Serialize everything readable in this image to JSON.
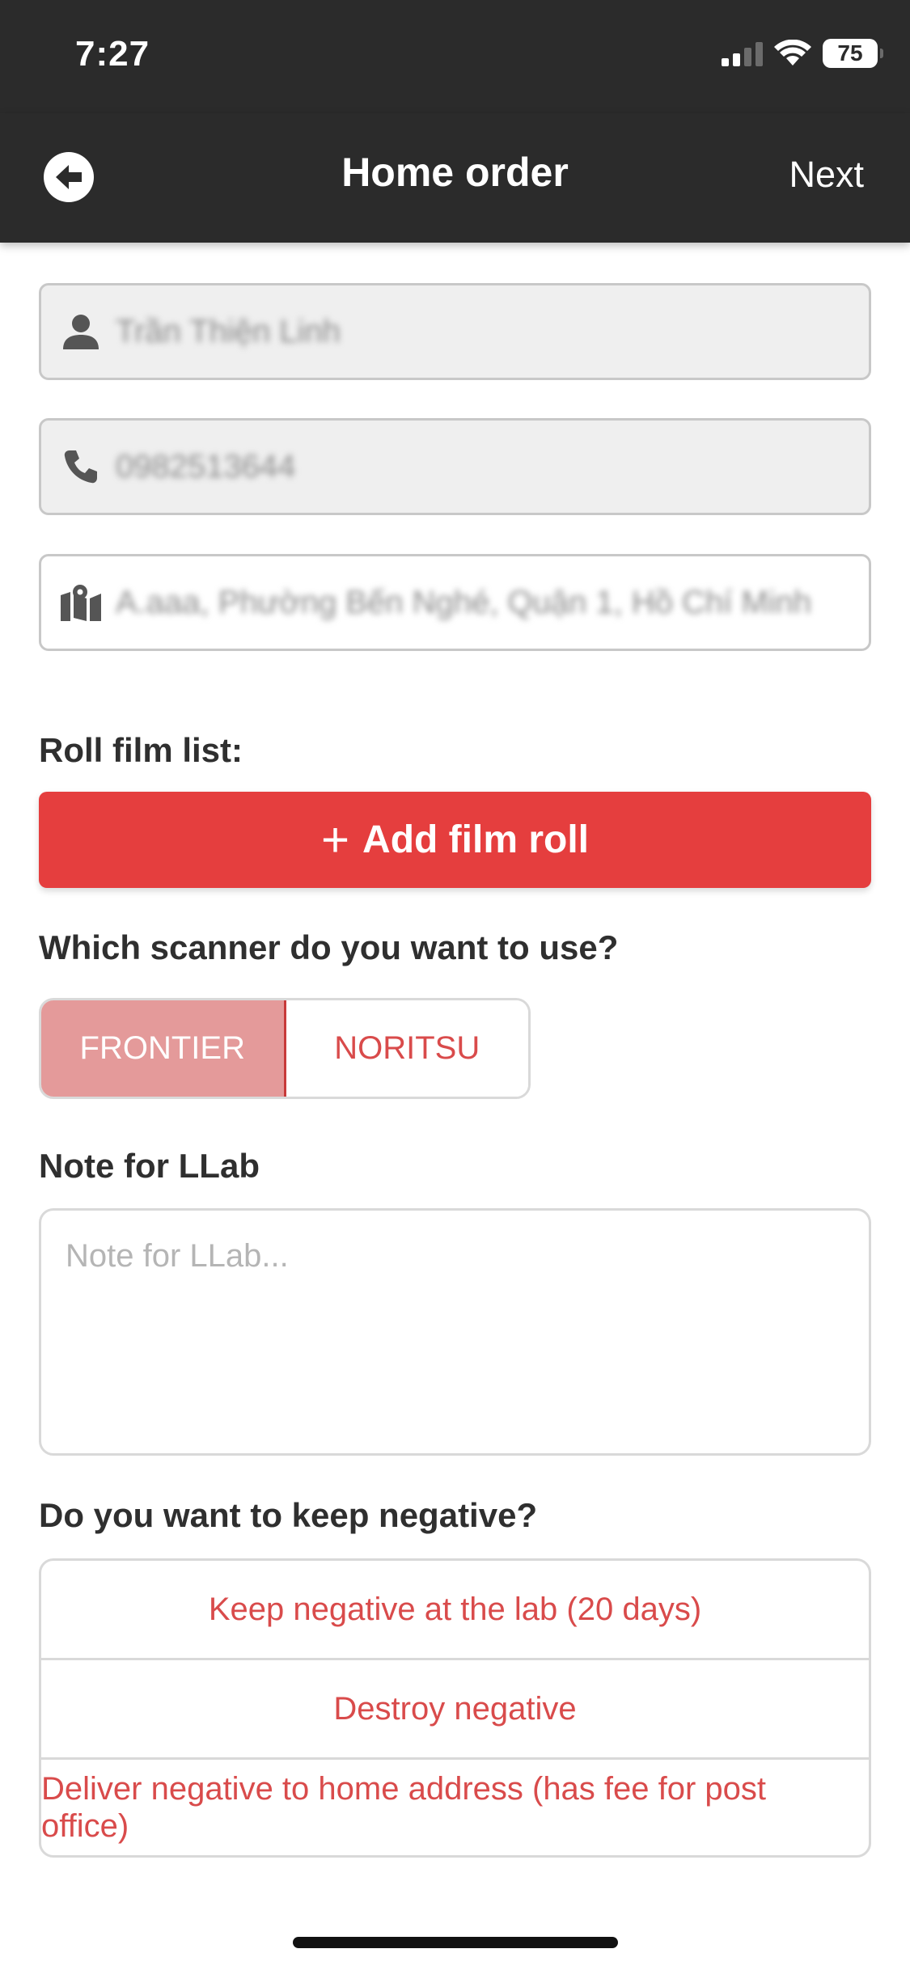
{
  "status_bar": {
    "time": "7:27",
    "battery": "75",
    "icons": [
      "cellular-signal-icon",
      "wifi-icon",
      "battery-icon"
    ]
  },
  "nav": {
    "back_icon": "arrow-left-circle-icon",
    "title": "Home order",
    "next_label": "Next"
  },
  "form": {
    "name": {
      "icon": "person-icon",
      "value": "Trần Thiện Linh"
    },
    "phone": {
      "icon": "phone-icon",
      "value": "0982513644"
    },
    "address": {
      "icon": "map-icon",
      "value": "A.aaa, Phường Bến Nghé, Quận 1, Hồ Chí Minh"
    }
  },
  "roll_film": {
    "label": "Roll film list:",
    "add_button": "Add film roll",
    "add_icon": "plus-icon"
  },
  "scanner": {
    "question": "Which scanner do you want to use?",
    "options": [
      "FRONTIER",
      "NORITSU"
    ],
    "selected": "FRONTIER"
  },
  "note": {
    "label": "Note for LLab",
    "placeholder": "Note for LLab..."
  },
  "negative": {
    "question": "Do you want to keep negative?",
    "options": [
      "Keep negative at the lab (20 days)",
      "Destroy negative",
      "Deliver negative to home address (has fee for post office)"
    ]
  },
  "colors": {
    "accent": "#e53e3e",
    "bar": "#2b2b2b",
    "selected_segment": "#e49a9a"
  }
}
